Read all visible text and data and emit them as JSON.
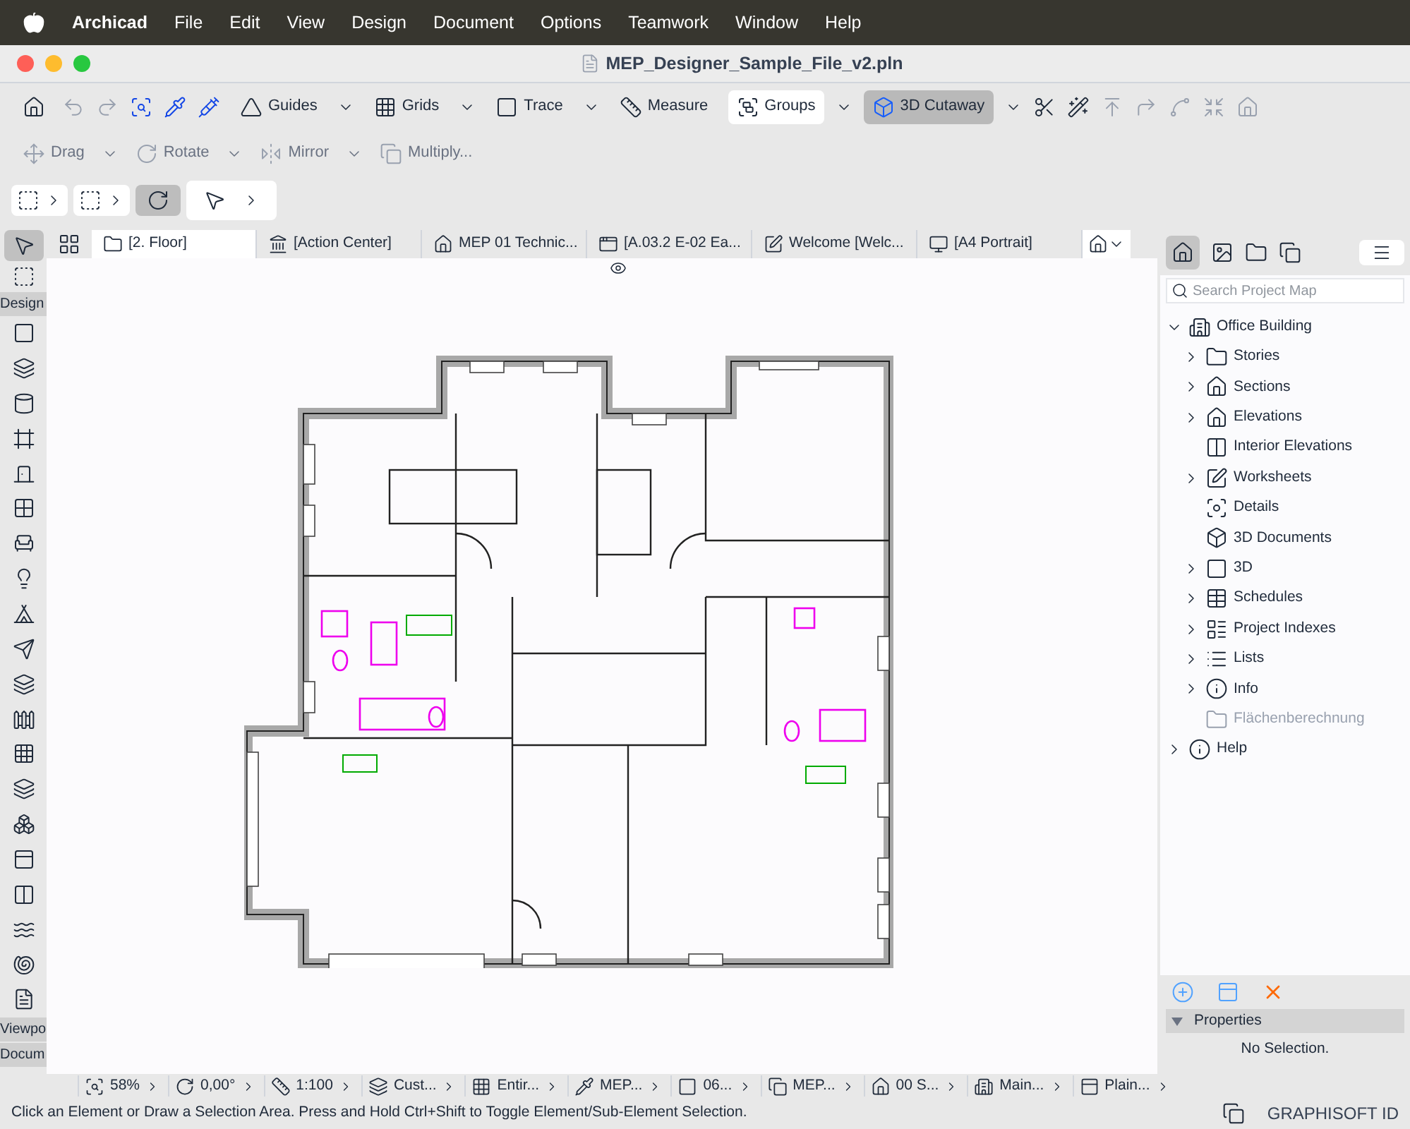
{
  "menu_bar": {
    "app": "Archicad",
    "items": [
      "File",
      "Edit",
      "View",
      "Design",
      "Document",
      "Options",
      "Teamwork",
      "Window",
      "Help"
    ]
  },
  "window": {
    "title": "MEP_Designer_Sample_File_v2.pln"
  },
  "toolbar": {
    "tools": [
      {
        "label": "Guides",
        "selected": false
      },
      {
        "label": "Grids",
        "selected": false
      },
      {
        "label": "Trace",
        "selected": false
      },
      {
        "label": "Measure",
        "selected": false
      },
      {
        "label": "Groups",
        "selected": false
      },
      {
        "label": "3D Cutaway",
        "selected": true
      }
    ]
  },
  "edit_toolbar": [
    "Drag",
    "Rotate",
    "Mirror",
    "Multiply..."
  ],
  "toolbox": {
    "sections": [
      "Design",
      "Viewpo",
      "Docum"
    ]
  },
  "tabs": [
    {
      "label": "[2. Floor]",
      "selected": true
    },
    {
      "label": "[Action Center]",
      "selected": false
    },
    {
      "label": "MEP 01 Technic...",
      "selected": false
    },
    {
      "label": "[A.03.2 E-02 Ea...",
      "selected": false
    },
    {
      "label": "Welcome [Welc...",
      "selected": false
    },
    {
      "label": "[A4 Portrait]",
      "selected": false
    }
  ],
  "project_map": {
    "search": {
      "placeholder": "Search Project Map"
    },
    "tree": [
      {
        "label": "Office Building",
        "expandable": true,
        "expanded": true,
        "disabled": false,
        "children": [
          {
            "label": "Stories",
            "expandable": true,
            "expanded": false,
            "disabled": false
          },
          {
            "label": "Sections",
            "expandable": true,
            "expanded": false,
            "disabled": false
          },
          {
            "label": "Elevations",
            "expandable": true,
            "expanded": false,
            "disabled": false
          },
          {
            "label": "Interior Elevations",
            "expandable": false,
            "expanded": false,
            "disabled": false
          },
          {
            "label": "Worksheets",
            "expandable": true,
            "expanded": false,
            "disabled": false
          },
          {
            "label": "Details",
            "expandable": false,
            "expanded": false,
            "disabled": false
          },
          {
            "label": "3D Documents",
            "expandable": false,
            "expanded": false,
            "disabled": false
          },
          {
            "label": "3D",
            "expandable": true,
            "expanded": false,
            "disabled": false
          },
          {
            "label": "Schedules",
            "expandable": true,
            "expanded": false,
            "disabled": false
          },
          {
            "label": "Project Indexes",
            "expandable": true,
            "expanded": false,
            "disabled": false
          },
          {
            "label": "Lists",
            "expandable": true,
            "expanded": false,
            "disabled": false
          },
          {
            "label": "Info",
            "expandable": true,
            "expanded": false,
            "disabled": false
          },
          {
            "label": "Flächenberechnung",
            "expandable": false,
            "expanded": false,
            "disabled": true
          }
        ]
      },
      {
        "label": "Help",
        "expandable": true,
        "expanded": false,
        "disabled": false
      }
    ]
  },
  "properties": {
    "title": "Properties",
    "expanded": true,
    "message": "No Selection."
  },
  "nav_bar": [
    "58%",
    "0,00°",
    "1:100",
    "Cust...",
    "Entir...",
    "MEP...",
    "06...",
    "MEP...",
    "00 S...",
    "Main...",
    "Plain..."
  ],
  "status_bar": {
    "hint": "Click an Element or Draw a Selection Area. Press and Hold Ctrl+Shift to Toggle Element/Sub-Element Selection.",
    "account": "GRAPHISOFT ID"
  }
}
